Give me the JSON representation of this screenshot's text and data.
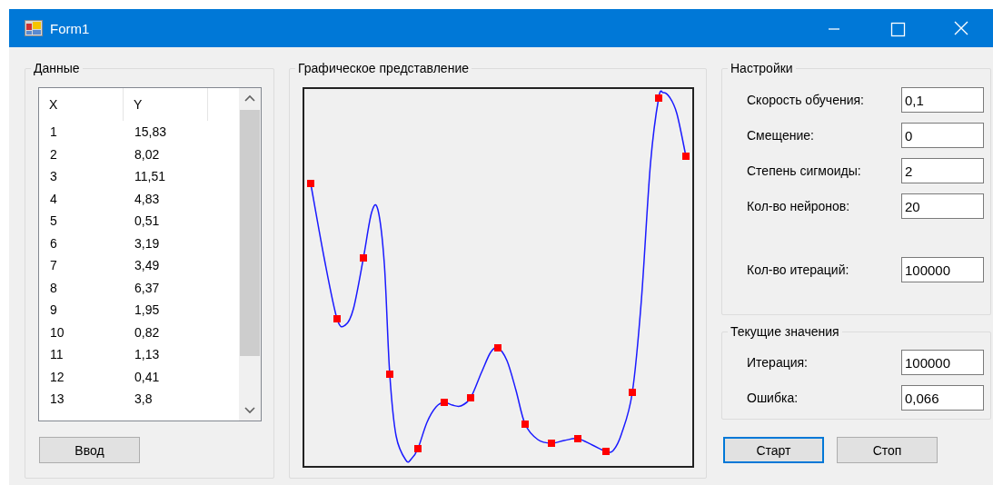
{
  "window": {
    "title": "Form1"
  },
  "data_group": {
    "title": "Данные",
    "columns": [
      "X",
      "Y"
    ],
    "rows": [
      [
        "1",
        "15,83"
      ],
      [
        "2",
        "8,02"
      ],
      [
        "3",
        "11,51"
      ],
      [
        "4",
        "4,83"
      ],
      [
        "5",
        "0,51"
      ],
      [
        "6",
        "3,19"
      ],
      [
        "7",
        "3,49"
      ],
      [
        "8",
        "6,37"
      ],
      [
        "9",
        "1,95"
      ],
      [
        "10",
        "0,82"
      ],
      [
        "11",
        "1,13"
      ],
      [
        "12",
        "0,41"
      ],
      [
        "13",
        "3,8"
      ]
    ],
    "button": {
      "label": "Ввод",
      "focused": false
    }
  },
  "graph_group": {
    "title": "Графическое представление"
  },
  "settings_group": {
    "title": "Настройки",
    "fields": [
      {
        "label": "Скорость обучения:",
        "value": "0,1"
      },
      {
        "label": "Смещение:",
        "value": "0"
      },
      {
        "label": "Степень сигмоиды:",
        "value": "2"
      },
      {
        "label": "Кол-во нейронов:",
        "value": "20"
      },
      {
        "label": "Кол-во итераций:",
        "value": "100000"
      }
    ]
  },
  "current_group": {
    "title": "Текущие значения",
    "fields": [
      {
        "label": "Итерация:",
        "value": "100000"
      },
      {
        "label": "Ошибка:",
        "value": "0,066"
      }
    ]
  },
  "buttons": [
    {
      "label": "Старт",
      "focused": true
    },
    {
      "label": "Стоп",
      "focused": false
    }
  ]
}
